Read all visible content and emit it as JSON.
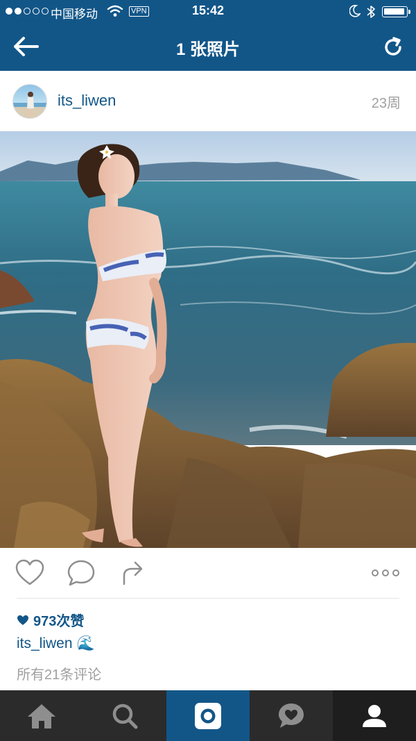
{
  "status_bar": {
    "carrier": "中国移动",
    "vpn": "VPN",
    "time": "15:42",
    "signal_bars_filled": 2,
    "signal_bars_total": 5,
    "battery_level": 0.85
  },
  "nav": {
    "title": "1 张照片",
    "back_icon": "arrow-left-icon",
    "refresh_icon": "refresh-icon"
  },
  "post": {
    "username": "its_liwen",
    "timestamp": "23周",
    "likes_text": "973次赞",
    "caption_user": "its_liwen",
    "caption_emoji": "🌊",
    "comments_link": "所有21条评论"
  },
  "actions": {
    "like_icon": "heart-outline-icon",
    "comment_icon": "comment-bubble-icon",
    "share_icon": "share-arrow-icon",
    "more_icon": "more-dots-icon"
  },
  "tabs": [
    {
      "name": "home-tab",
      "icon": "home-icon"
    },
    {
      "name": "explore-tab",
      "icon": "search-icon"
    },
    {
      "name": "camera-tab",
      "icon": "camera-icon",
      "active": true
    },
    {
      "name": "activity-tab",
      "icon": "activity-heart-icon"
    },
    {
      "name": "profile-tab",
      "icon": "profile-icon"
    }
  ],
  "colors": {
    "brand_blue": "#125688",
    "tab_bar": "#2b2b2b",
    "timestamp_gray": "#a0a0a0"
  }
}
